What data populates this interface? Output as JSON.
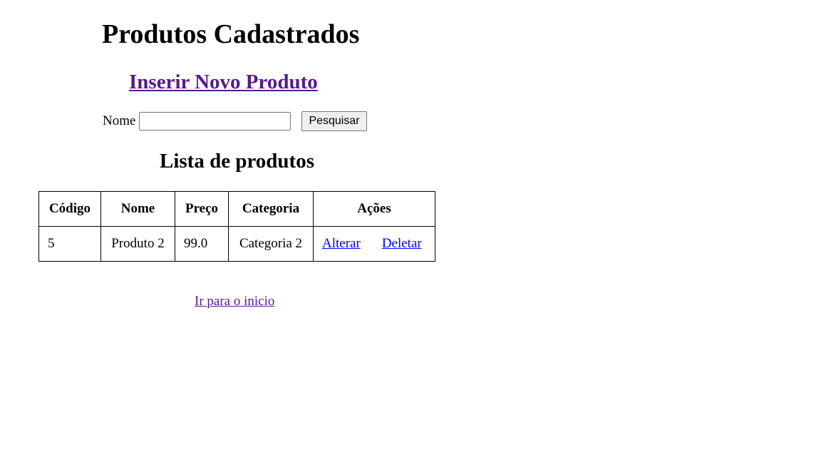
{
  "page": {
    "title": "Produtos Cadastrados",
    "new_product_link": "Inserir Novo Produto",
    "list_title": "Lista de produtos",
    "home_link": "Ir para o inicio"
  },
  "search": {
    "label": "Nome",
    "value": "",
    "placeholder": "",
    "button_label": "Pesquisar"
  },
  "table": {
    "headers": [
      "Código",
      "Nome",
      "Preço",
      "Categoria",
      "Ações"
    ],
    "rows": [
      {
        "codigo": "5",
        "nome": "Produto 2",
        "preco": "99.0",
        "categoria": "Categoria 2",
        "alterar": "Alterar",
        "deletar": "Deletar"
      }
    ]
  },
  "colors": {
    "visited_link": "#551a8b",
    "link": "#0000ee"
  }
}
